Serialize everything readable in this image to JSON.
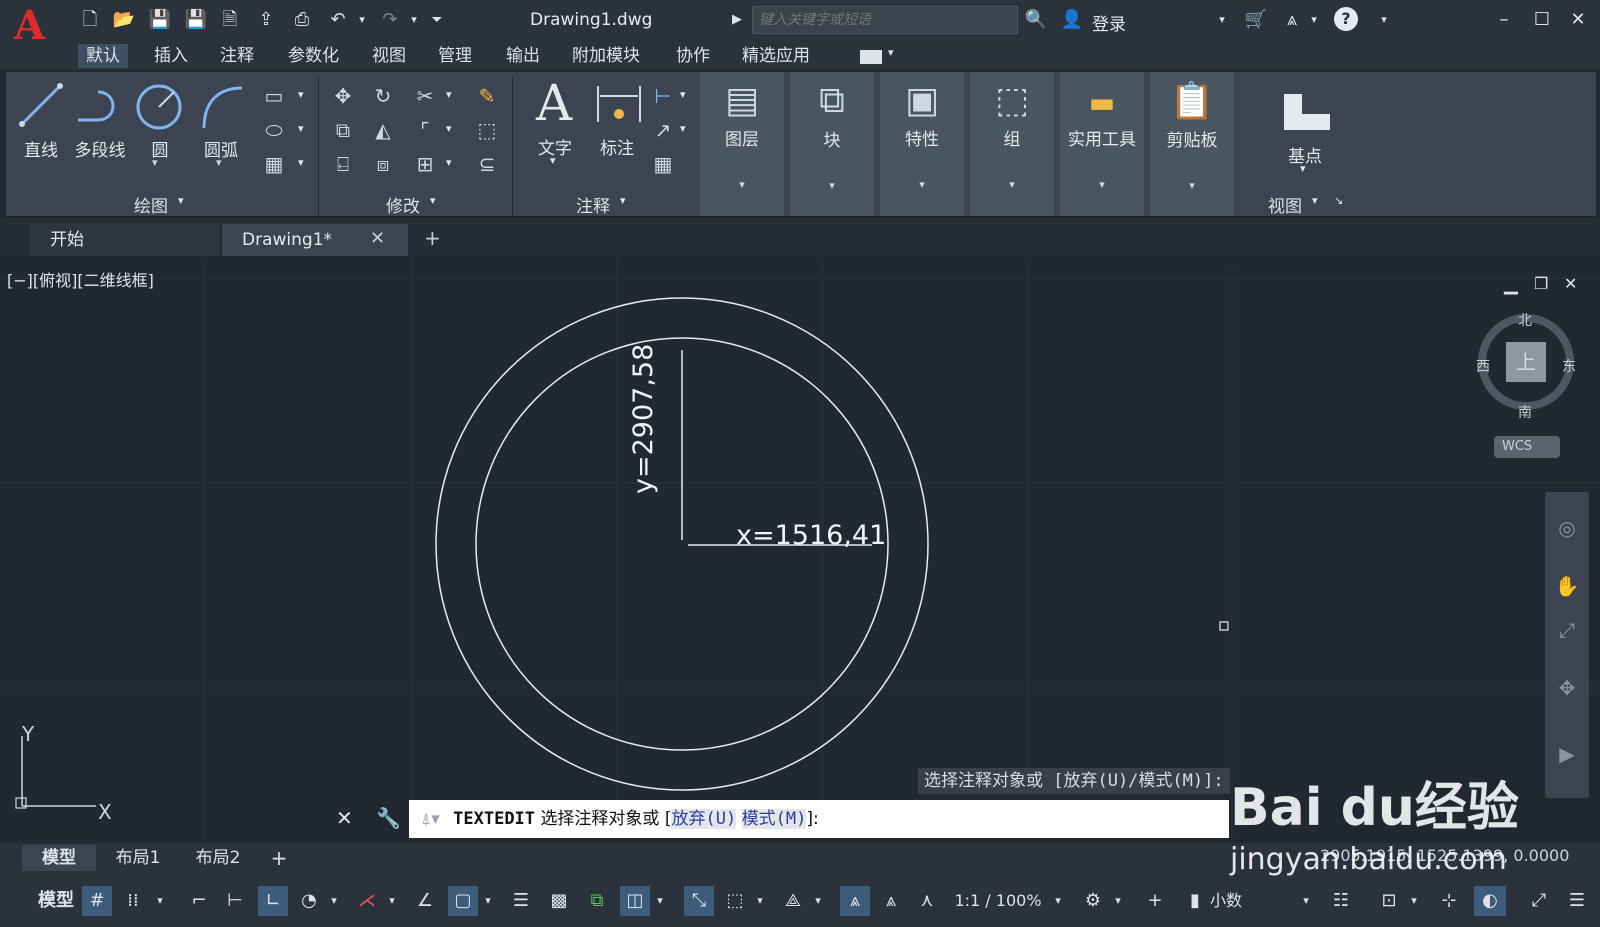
{
  "app": {
    "logo_letter": "A",
    "document_title": "Drawing1.dwg",
    "search_placeholder": "键入关键字或短语",
    "login_label": "登录"
  },
  "menu_tabs": [
    "默认",
    "插入",
    "注释",
    "参数化",
    "视图",
    "管理",
    "输出",
    "附加模块",
    "协作",
    "精选应用"
  ],
  "ribbon": {
    "draw": {
      "line": "直线",
      "polyline": "多段线",
      "circle": "圆",
      "arc": "圆弧",
      "panel_title": "绘图"
    },
    "modify": {
      "panel_title": "修改"
    },
    "annotation": {
      "text": "文字",
      "dimension": "标注",
      "panel_title": "注释"
    },
    "layers": "图层",
    "block": "块",
    "properties": "特性",
    "groups": "组",
    "utilities": "实用工具",
    "clipboard": "剪贴板",
    "view": {
      "base": "基点",
      "panel_title": "视图"
    }
  },
  "file_tabs": {
    "start": "开始",
    "drawing": "Drawing1*",
    "add": "+"
  },
  "viewport": {
    "label": "[−][俯视][二维线框]",
    "y_annotation": "y=2907,58",
    "x_annotation": "x=1516,41",
    "viewcube": {
      "north": "北",
      "south": "南",
      "east": "东",
      "west": "西",
      "top": "上",
      "wcs": "WCS"
    },
    "ucs_y": "Y",
    "ucs_x": "X"
  },
  "command": {
    "prompt_hint": "选择注释对象或 [放弃(U)/模式(M)]:",
    "command_name": "TEXTEDIT",
    "text": "选择注释对象或",
    "option_undo": "放弃(U)",
    "option_mode": "模式(M)",
    "bracket_open": "[",
    "bracket_close": "]:"
  },
  "layout_tabs": [
    "模型",
    "布局1",
    "布局2"
  ],
  "status": {
    "coords": "2905.1915, 1525.1399, 0.0000",
    "model": "模型",
    "scale": "1:1 / 100%",
    "units": "小数"
  },
  "watermark": {
    "brand": "Bai du经验",
    "url": "jingyan.baidu.com"
  },
  "colors": {
    "accent": "#3d5b7a",
    "logo": "#e02b2b",
    "canvas": "#212830"
  }
}
